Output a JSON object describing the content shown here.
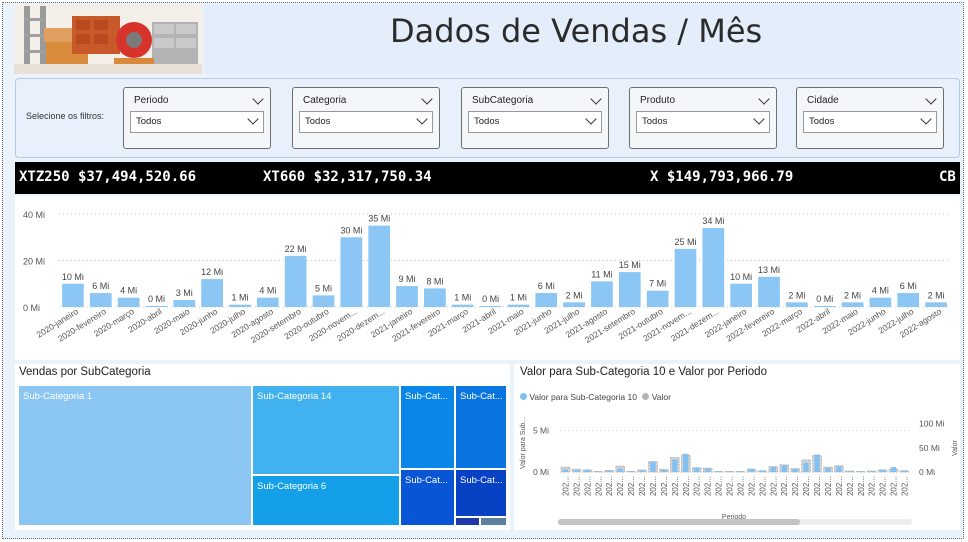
{
  "header": {
    "title": "Dados de Vendas / Mês"
  },
  "filters": {
    "label": "Selecione os filtros:",
    "slicers": [
      {
        "name": "Periodo",
        "value": "Todos"
      },
      {
        "name": "Categoria",
        "value": "Todos"
      },
      {
        "name": "SubCategoria",
        "value": "Todos"
      },
      {
        "name": "Produto",
        "value": "Todos"
      },
      {
        "name": "Cidade",
        "value": "Todos"
      }
    ]
  },
  "ticker": {
    "items": [
      "XTZ250 $37,494,520.66",
      "XT660 $32,317,750.34",
      "X $149,793,966.79",
      "CB"
    ]
  },
  "monthly_chart": {
    "yticks": [
      "40 Mi",
      "20 Mi",
      "0 Mi"
    ]
  },
  "treemap": {
    "title": "Vendas por SubCategoria",
    "tiles": [
      {
        "label": "Sub-Categoria 1",
        "color": "#8cc6f2"
      },
      {
        "label": "Sub-Categoria 14",
        "color": "#41b1ef"
      },
      {
        "label": "Sub-Categoria 6",
        "color": "#13a0e8"
      },
      {
        "label": "Sub-Cat...",
        "color": "#0a86e8"
      },
      {
        "label": "Sub-Cat...",
        "color": "#0a74e0"
      },
      {
        "label": "Sub-Cat...",
        "color": "#0855d6"
      },
      {
        "label": "Sub-Cat...",
        "color": "#0842c4"
      },
      {
        "label": "",
        "color": "#1d3aa8"
      },
      {
        "label": "",
        "color": "#5c7fa0"
      }
    ]
  },
  "combo": {
    "title": "Valor para Sub-Categoria 10 e Valor por Periodo",
    "legend": [
      {
        "name": "Valor para Sub-Categoria 10",
        "color": "#80c0f2"
      },
      {
        "name": "Valor",
        "color": "#b4b4b4"
      }
    ],
    "left_axis_title": "Valor para Sub...",
    "right_axis_title": "Valor",
    "left_ticks": [
      "5 Mi",
      "0 Mi"
    ],
    "right_ticks": [
      "100 Mi",
      "50 Mi",
      "0 Mi"
    ],
    "x_title": "Periodo",
    "x_tick_label": "202..."
  },
  "chart_data": [
    {
      "type": "bar",
      "title": "",
      "categories": [
        "2020-janeiro",
        "2020-fevereiro",
        "2020-março",
        "2020-abril",
        "2020-maio",
        "2020-junho",
        "2020-julho",
        "2020-agosto",
        "2020-setembro",
        "2020-outubro",
        "2020-novem...",
        "2020-dezem...",
        "2021-janeiro",
        "2021-fevereiro",
        "2021-março",
        "2021-abril",
        "2021-maio",
        "2021-junho",
        "2021-julho",
        "2021-agosto",
        "2021-setembro",
        "2021-outubro",
        "2021-novem...",
        "2021-dezem...",
        "2022-janeiro",
        "2022-fevereiro",
        "2022-março",
        "2022-abril",
        "2022-maio",
        "2022-junho",
        "2022-julho",
        "2022-agosto"
      ],
      "values": [
        10,
        6,
        4,
        0.3,
        3,
        12,
        1,
        4,
        22,
        5,
        30,
        35,
        9,
        8,
        1,
        0.3,
        1,
        6,
        2,
        11,
        15,
        7,
        25,
        34,
        10,
        13,
        2,
        0.3,
        2,
        4,
        6,
        2
      ],
      "data_labels": [
        "10 Mi",
        "6 Mi",
        "4 Mi",
        "0 Mi",
        "3 Mi",
        "12 Mi",
        "1 Mi",
        "4 Mi",
        "22 Mi",
        "5 Mi",
        "30 Mi",
        "35 Mi",
        "9 Mi",
        "8 Mi",
        "1 Mi",
        "0 Mi",
        "1 Mi",
        "6 Mi",
        "2 Mi",
        "11 Mi",
        "15 Mi",
        "7 Mi",
        "25 Mi",
        "34 Mi",
        "10 Mi",
        "13 Mi",
        "2 Mi",
        "0 Mi",
        "2 Mi",
        "4 Mi",
        "6 Mi",
        "2 Mi"
      ],
      "ylim": [
        0,
        40
      ],
      "yticks": [
        0,
        20,
        40
      ],
      "grid": true,
      "color": "#8cc6f5"
    },
    {
      "type": "bar",
      "title": "Valor para Sub-Categoria 10 e Valor por Periodo",
      "series": [
        {
          "name": "Valor para Sub-Categoria 10",
          "values": [
            0.3,
            0.2,
            0.3,
            0.1,
            0.2,
            0.4,
            0.1,
            0.2,
            1.2,
            0.3,
            1.5,
            2.2,
            0.5,
            0.4,
            0.1,
            0.1,
            0.1,
            0.4,
            0.2,
            0.6,
            0.8,
            0.4,
            1.1,
            2.1,
            0.5,
            0.7,
            0.1,
            0.1,
            0.1,
            0.3,
            0.6,
            0.2
          ],
          "axis": "left"
        },
        {
          "name": "Valor",
          "values": [
            10,
            6,
            4,
            0.3,
            3,
            12,
            1,
            4,
            22,
            5,
            30,
            35,
            9,
            8,
            1,
            0.3,
            1,
            6,
            2,
            11,
            15,
            7,
            25,
            34,
            10,
            13,
            2,
            0.3,
            2,
            4,
            6,
            2
          ],
          "axis": "right"
        }
      ],
      "ylim_left": [
        0,
        7
      ],
      "ylim_right": [
        0,
        120
      ],
      "xlabel": "Periodo"
    }
  ]
}
